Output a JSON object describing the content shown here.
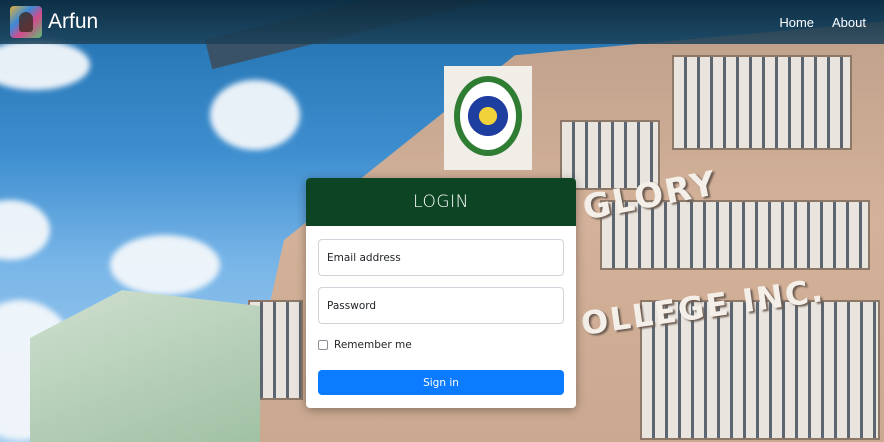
{
  "navbar": {
    "brand": "Arfun",
    "links": [
      "Home",
      "About"
    ]
  },
  "background": {
    "sign_line1": "GLORY",
    "sign_line2": "OLLEGE INC."
  },
  "login": {
    "title": "LOGIN",
    "email_placeholder": "Email address",
    "password_placeholder": "Password",
    "remember_label": "Remember me",
    "submit_label": "Sign in"
  },
  "colors": {
    "header_green": "#0c4424",
    "button_blue": "#0b7bff"
  }
}
